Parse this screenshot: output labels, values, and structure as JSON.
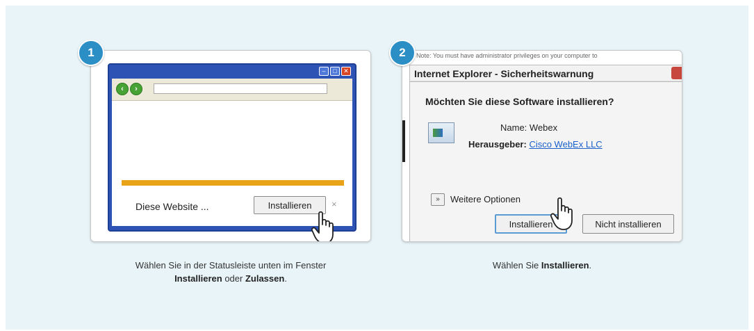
{
  "step1": {
    "number": "1",
    "infobar_text": "Diese Website ...",
    "install_button": "Installieren",
    "close_glyph": "×",
    "caption_line1": "Wählen Sie in der Statusleiste unten im Fenster",
    "caption_bold1": "Installieren",
    "caption_mid": " oder ",
    "caption_bold2": "Zulassen",
    "caption_end": "."
  },
  "step2": {
    "number": "2",
    "note_text": "Note: You must have administrator privileges on your computer to",
    "dialog_title": "Internet Explorer - Sicherheitswarnung",
    "question": "Möchten Sie diese Software installieren?",
    "name_label": "Name:",
    "name_value": "Webex",
    "publisher_label": "Herausgeber:",
    "publisher_value": "Cisco WebEx LLC",
    "more_options": "Weitere Optionen",
    "install_button": "Installieren",
    "no_install_button": "Nicht installieren",
    "caption_prefix": "Wählen Sie ",
    "caption_bold": "Installieren",
    "caption_end": "."
  },
  "colors": {
    "badge": "#2b8fc6",
    "background": "#e9f4f8",
    "infobar_accent": "#e8a317",
    "browser_frame": "#2d54b5",
    "link": "#1a5fc9"
  },
  "icons": [
    "back-arrow-icon",
    "forward-arrow-icon",
    "minimize-icon",
    "maximize-icon",
    "close-icon",
    "hand-cursor-icon",
    "software-icon",
    "expand-chevron-icon"
  ]
}
